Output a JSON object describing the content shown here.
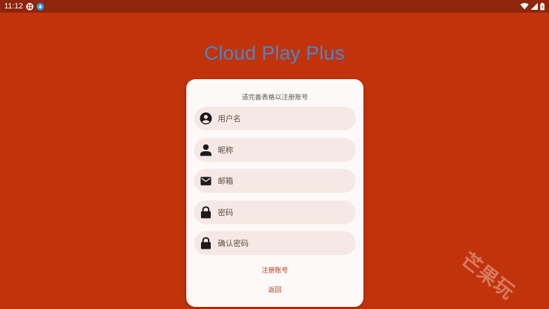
{
  "status_bar": {
    "time": "11:12",
    "icons": [
      "photo-grid-icon",
      "download-badge-icon",
      "wifi-icon",
      "signal-icon",
      "battery-icon"
    ]
  },
  "app": {
    "title": "Cloud Play Plus",
    "title_color": "#4a86c8",
    "background_color": "#c1330b"
  },
  "form": {
    "subtitle": "请完善表格以注册账号",
    "fields": [
      {
        "icon": "account-circle-icon",
        "placeholder": "用户名",
        "value": ""
      },
      {
        "icon": "person-icon",
        "placeholder": "昵称",
        "value": ""
      },
      {
        "icon": "mail-icon",
        "placeholder": "邮箱",
        "value": ""
      },
      {
        "icon": "lock-icon",
        "placeholder": "密码",
        "value": ""
      },
      {
        "icon": "lock-icon",
        "placeholder": "确认密码",
        "value": ""
      }
    ],
    "register_label": "注册账号",
    "back_label": "返回"
  },
  "watermark": {
    "text": "芒果玩"
  }
}
